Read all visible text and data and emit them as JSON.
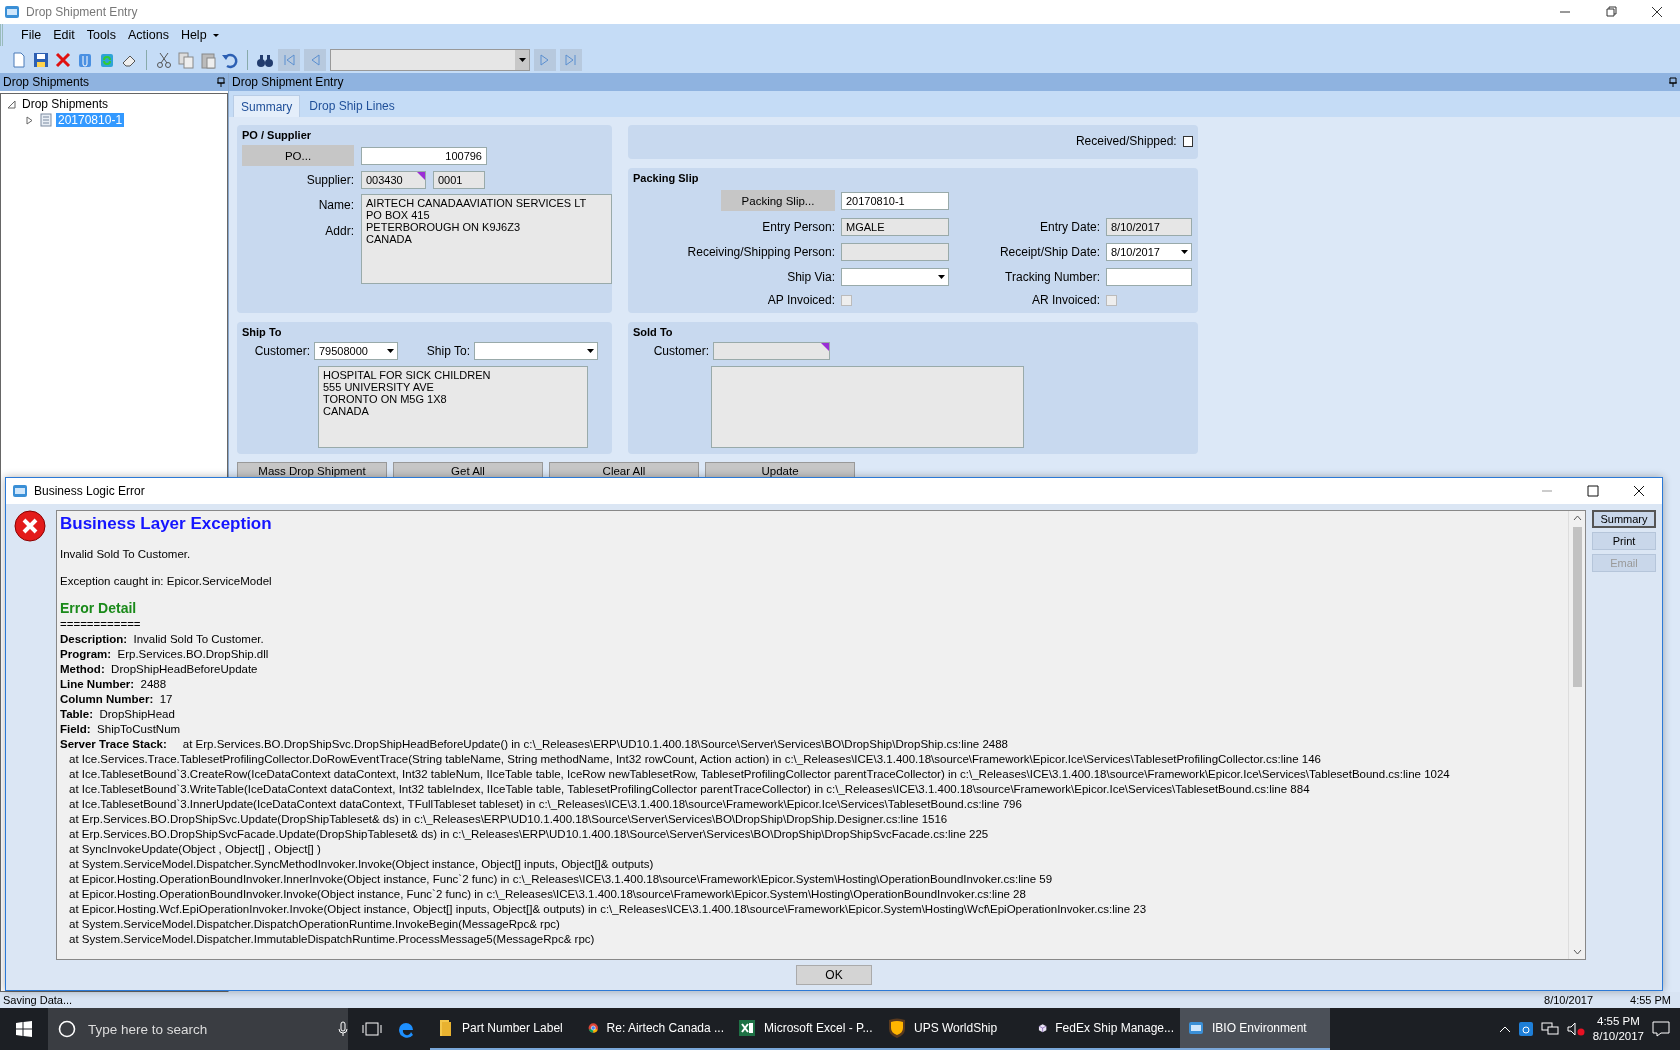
{
  "window": {
    "title": "Drop Shipment Entry"
  },
  "menu": [
    "File",
    "Edit",
    "Tools",
    "Actions",
    "Help"
  ],
  "tree_panel": {
    "title": "Drop Shipments",
    "tree": [
      {
        "label": "Drop Shipments",
        "expanded": true,
        "children": [
          {
            "label": "20170810-1",
            "selected": true,
            "expanded": false
          }
        ]
      }
    ]
  },
  "entry_panel": {
    "title": "Drop Shipment Entry"
  },
  "tabs": [
    {
      "label": "Summary",
      "selected": true
    },
    {
      "label": "Drop Ship Lines",
      "selected": false
    }
  ],
  "po_supplier": {
    "title": "PO / Supplier",
    "po_button": "PO...",
    "po_value": "100796",
    "supplier_label": "Supplier:",
    "supplier_id": "003430",
    "supplier_code": "0001",
    "name_label": "Name:",
    "addr_label": "Addr:",
    "address_lines": [
      "AIRTECH CANADAAVIATION SERVICES LT",
      "PO BOX 415",
      "PETERBOROUGH ON K9J6Z3",
      "CANADA"
    ]
  },
  "received_shipped": {
    "label": "Received/Shipped:",
    "checked": false
  },
  "packing_slip": {
    "title": "Packing Slip",
    "button": "Packing Slip...",
    "value": "20170810-1",
    "entry_person_label": "Entry Person:",
    "entry_person": "MGALE",
    "entry_date_label": "Entry Date:",
    "entry_date": "8/10/2017",
    "receiving_person_label": "Receiving/Shipping Person:",
    "receipt_date_label": "Receipt/Ship Date:",
    "receipt_date": "8/10/2017",
    "ship_via_label": "Ship Via:",
    "tracking_label": "Tracking Number:",
    "ap_invoiced": {
      "label": "AP Invoiced:",
      "checked": false,
      "disabled": true
    },
    "ar_invoiced": {
      "label": "AR Invoiced:",
      "checked": false,
      "disabled": true
    }
  },
  "ship_to": {
    "title": "Ship To",
    "customer_label": "Customer:",
    "customer_value": "79508000",
    "ship_to_label": "Ship To:",
    "address_lines": [
      "HOSPITAL FOR SICK CHILDREN",
      "555 UNIVERSITY AVE",
      "TORONTO ON M5G 1X8",
      "CANADA"
    ]
  },
  "sold_to": {
    "title": "Sold To",
    "customer_label": "Customer:"
  },
  "action_buttons": [
    "Mass Drop Shipment",
    "Get All",
    "Clear All",
    "Update"
  ],
  "status_bar": {
    "text": "Saving Data...",
    "date": "8/10/2017",
    "time": "4:55 PM"
  },
  "dialog": {
    "title": "Business Logic Error",
    "heading": "Business Layer Exception",
    "message": "Invalid Sold To Customer.",
    "caught": "Exception caught in: Epicor.ServiceModel",
    "detail_heading": "Error Detail",
    "separator": "============",
    "details": [
      {
        "label": "Description:",
        "value": "Invalid Sold To Customer."
      },
      {
        "label": "Program:",
        "value": "Erp.Services.BO.DropShip.dll"
      },
      {
        "label": "Method:",
        "value": "DropShipHeadBeforeUpdate"
      },
      {
        "label": "Line Number:",
        "value": "2488"
      },
      {
        "label": "Column Number:",
        "value": "17"
      },
      {
        "label": "Table:",
        "value": "DropShipHead"
      },
      {
        "label": "Field:",
        "value": "ShipToCustNum"
      }
    ],
    "trace_label": "Server Trace Stack:",
    "trace": [
      "at Erp.Services.BO.DropShipSvc.DropShipHeadBeforeUpdate() in c:\\_Releases\\ERP\\UD10.1.400.18\\Source\\Server\\Services\\BO\\DropShip\\DropShip.cs:line 2488",
      "at Ice.Services.Trace.TablesetProfilingCollector.DoRowEventTrace(String tableName, String methodName, Int32 rowCount, Action action) in c:\\_Releases\\ICE\\3.1.400.18\\source\\Framework\\Epicor.Ice\\Services\\TablesetProfilingCollector.cs:line 146",
      "at Ice.TablesetBound`3.CreateRow(IceDataContext dataContext, Int32 tableNum, IIceTable table, IceRow newTablesetRow, TablesetProfilingCollector parentTraceCollector) in c:\\_Releases\\ICE\\3.1.400.18\\source\\Framework\\Epicor.Ice\\Services\\TablesetBound.cs:line 1024",
      "at Ice.TablesetBound`3.WriteTable(IceDataContext dataContext, Int32 tableIndex, IIceTable table, TablesetProfilingCollector parentTraceCollector) in c:\\_Releases\\ICE\\3.1.400.18\\source\\Framework\\Epicor.Ice\\Services\\TablesetBound.cs:line 884",
      "at Ice.TablesetBound`3.InnerUpdate(IceDataContext dataContext, TFullTableset tableset) in c:\\_Releases\\ICE\\3.1.400.18\\source\\Framework\\Epicor.Ice\\Services\\TablesetBound.cs:line 796",
      "at Erp.Services.BO.DropShipSvc.Update(DropShipTableset& ds) in c:\\_Releases\\ERP\\UD10.1.400.18\\Source\\Server\\Services\\BO\\DropShip\\DropShip.Designer.cs:line 1516",
      "at Erp.Services.BO.DropShipSvcFacade.Update(DropShipTableset& ds) in c:\\_Releases\\ERP\\UD10.1.400.18\\Source\\Server\\Services\\BO\\DropShip\\DropShipSvcFacade.cs:line 225",
      "at SyncInvokeUpdate(Object , Object[] , Object[] )",
      "at System.ServiceModel.Dispatcher.SyncMethodInvoker.Invoke(Object instance, Object[] inputs, Object[]& outputs)",
      "at Epicor.Hosting.OperationBoundInvoker.InnerInvoke(Object instance, Func`2 func) in c:\\_Releases\\ICE\\3.1.400.18\\source\\Framework\\Epicor.System\\Hosting\\OperationBoundInvoker.cs:line 59",
      "at Epicor.Hosting.OperationBoundInvoker.Invoke(Object instance, Func`2 func) in c:\\_Releases\\ICE\\3.1.400.18\\source\\Framework\\Epicor.System\\Hosting\\OperationBoundInvoker.cs:line 28",
      "at Epicor.Hosting.Wcf.EpiOperationInvoker.Invoke(Object instance, Object[] inputs, Object[]& outputs) in c:\\_Releases\\ICE\\3.1.400.18\\source\\Framework\\Epicor.System\\Hosting\\Wcf\\EpiOperationInvoker.cs:line 23",
      "at System.ServiceModel.Dispatcher.DispatchOperationRuntime.InvokeBegin(MessageRpc& rpc)",
      "at System.ServiceModel.Dispatcher.ImmutableDispatchRuntime.ProcessMessage5(MessageRpc& rpc)"
    ],
    "side_buttons": [
      {
        "label": "Summary",
        "disabled": false,
        "selected": true
      },
      {
        "label": "Print",
        "disabled": false,
        "selected": false
      },
      {
        "label": "Email",
        "disabled": true,
        "selected": false
      }
    ],
    "ok": "OK"
  },
  "taskbar": {
    "search_placeholder": "Type here to search",
    "apps": [
      {
        "label": "Part Number Label",
        "kind": "folder",
        "selected": false
      },
      {
        "label": "Re: Airtech Canada ...",
        "kind": "browser",
        "selected": false
      },
      {
        "label": "Microsoft Excel - P...",
        "kind": "sheet",
        "selected": false
      },
      {
        "label": "UPS WorldShip",
        "kind": "shield",
        "selected": false
      },
      {
        "label": "FedEx Ship Manage...",
        "kind": "box",
        "selected": false
      },
      {
        "label": "IBIO Environment",
        "kind": "window",
        "selected": true
      }
    ],
    "time": "4:55 PM",
    "date": "8/10/2017"
  }
}
